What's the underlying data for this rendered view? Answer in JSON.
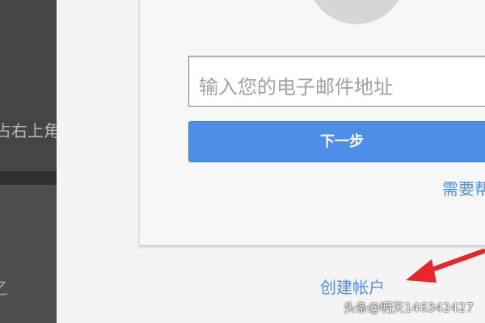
{
  "left_panel": {
    "partial_text": "占右上角",
    "partial_mark": "之"
  },
  "signin": {
    "email_placeholder": "输入您的电子邮件地址",
    "next_label": "下一步",
    "help_label": "需要帮",
    "create_account_label": "创建帐户"
  },
  "annotation": {
    "arrow_color": "#e8262a"
  },
  "watermark": {
    "text": "头条@明天146342427"
  }
}
